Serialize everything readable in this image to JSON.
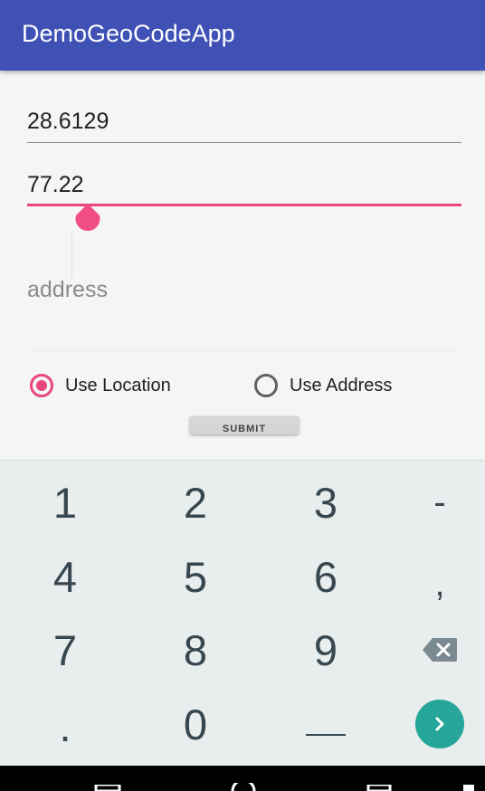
{
  "app": {
    "title": "DemoGeoCodeApp"
  },
  "form": {
    "latitude_value": "28.6129",
    "longitude_value": "77.22",
    "address_placeholder": "address",
    "address_value": ""
  },
  "radio_options": [
    {
      "label": "Use Location",
      "checked": true
    },
    {
      "label": "Use Address",
      "checked": false
    }
  ],
  "submit_label": "SUBMIT",
  "keyboard": {
    "rows": [
      [
        "1",
        "2",
        "3",
        "-"
      ],
      [
        "4",
        "5",
        "6",
        ","
      ],
      [
        "7",
        "8",
        "9",
        "backspace-icon"
      ],
      [
        ".",
        "0",
        "_",
        "go-icon"
      ]
    ]
  },
  "colors": {
    "app_bar": "#3f51b5",
    "accent": "#e8467c",
    "go_key": "#26a69a",
    "keyboard_bg": "#e8edee"
  }
}
